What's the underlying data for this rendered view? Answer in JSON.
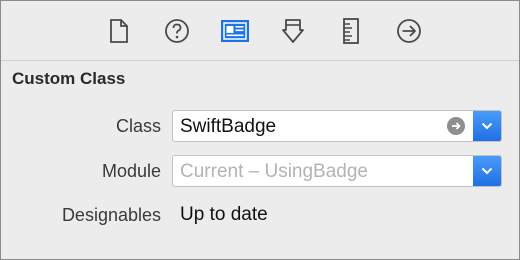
{
  "toolbar": {
    "icons": [
      {
        "name": "file-inspector-icon"
      },
      {
        "name": "quick-help-icon"
      },
      {
        "name": "identity-inspector-icon",
        "selected": true,
        "color": "#1a73e8"
      },
      {
        "name": "attributes-inspector-icon"
      },
      {
        "name": "size-inspector-icon"
      },
      {
        "name": "connections-inspector-icon"
      }
    ]
  },
  "custom_class": {
    "title": "Custom Class",
    "class_label": "Class",
    "class_value": "SwiftBadge",
    "module_label": "Module",
    "module_placeholder": "Current – UsingBadge",
    "designables_label": "Designables",
    "designables_value": "Up to date"
  },
  "colors": {
    "accent": "#1a73e8",
    "background": "#ececec"
  }
}
